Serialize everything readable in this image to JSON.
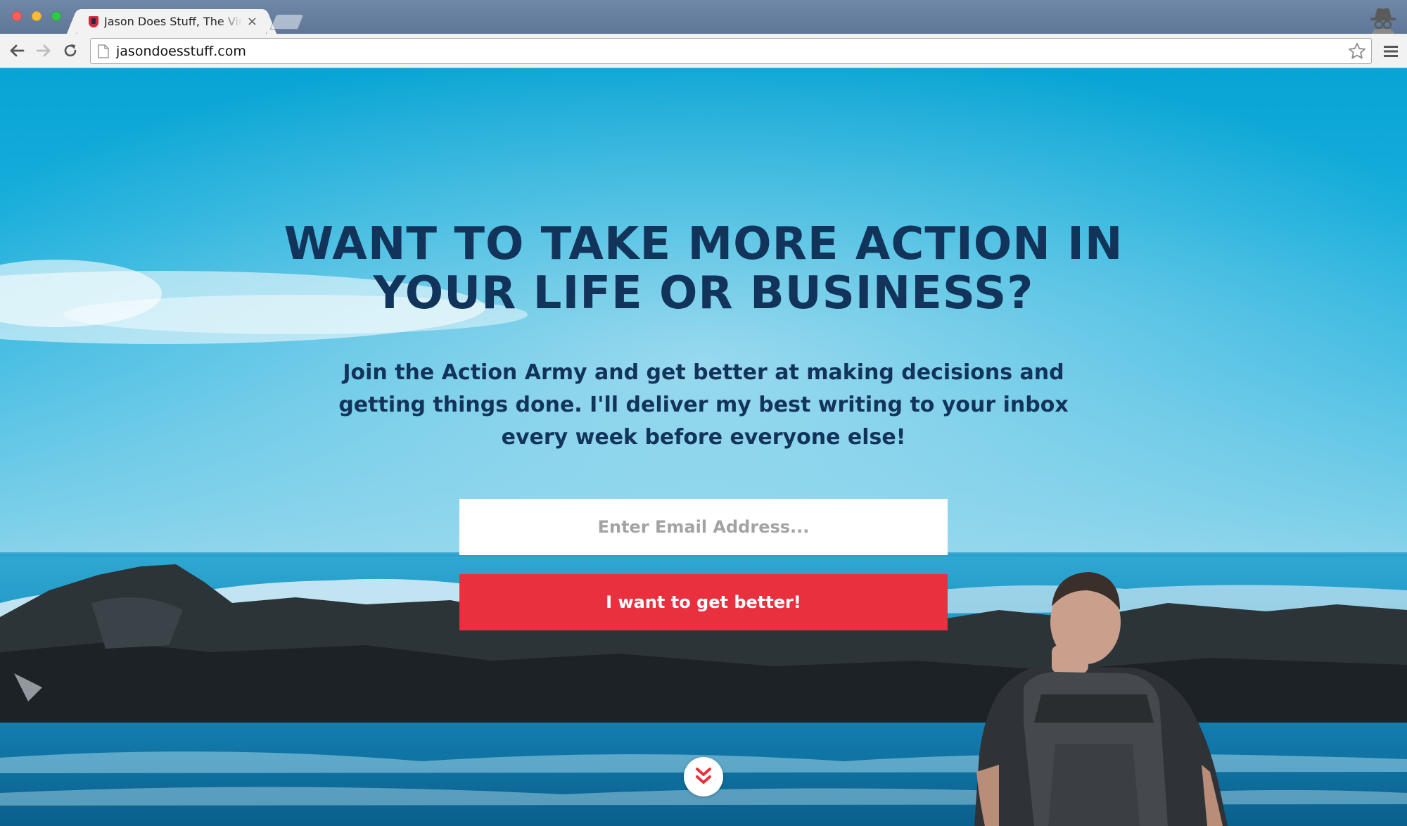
{
  "browser": {
    "tab_title": "Jason Does Stuff, The Virtual Assistant",
    "tab_close": "×",
    "url": "jasondoesstuff.com",
    "icons": {
      "back": "back-arrow-icon",
      "forward": "forward-arrow-icon",
      "reload": "reload-icon",
      "page": "page-icon",
      "bookmark": "star-icon",
      "menu": "hamburger-menu-icon",
      "profile": "incognito-icon"
    }
  },
  "hero": {
    "headline": "WANT TO TAKE MORE ACTION IN YOUR LIFE OR BUSINESS?",
    "subheadline": "Join the Action Army and get better at making decisions and getting things done. I'll deliver my best writing to your inbox every week before everyone else!",
    "email_placeholder": "Enter Email Address...",
    "email_value": "",
    "cta_label": "I want to get better!",
    "scroll_icon": "double-chevron-down-icon"
  },
  "colors": {
    "headline": "#12345a",
    "cta_background": "#e8303e",
    "cta_text": "#ffffff",
    "sky": "#08a4d4"
  }
}
